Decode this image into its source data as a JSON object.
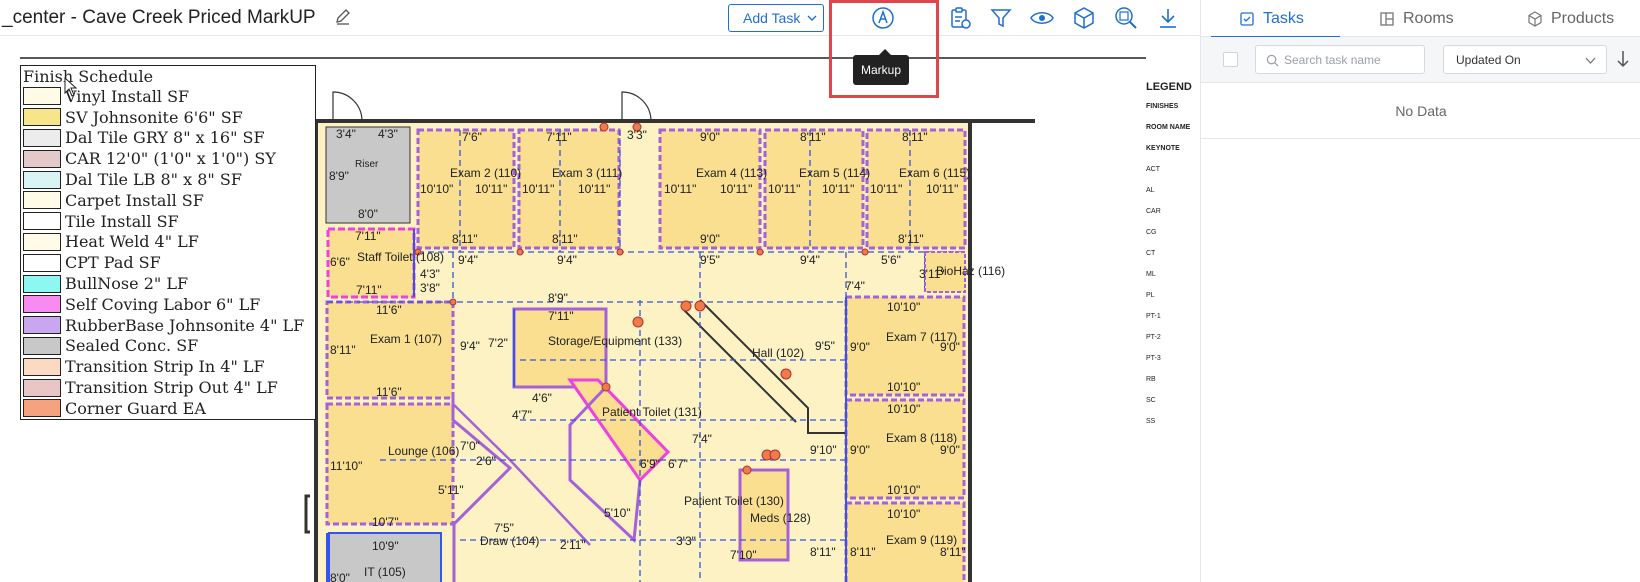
{
  "header": {
    "title": "_center - Cave Creek Priced MarkUP",
    "add_task_label": "Add Task",
    "tooltip": "Markup"
  },
  "toolbar": {
    "icons": [
      "markup-icon",
      "task-list-icon",
      "filter-icon",
      "eye-icon",
      "cube-icon",
      "zoom-icon",
      "download-icon"
    ]
  },
  "panel": {
    "tabs": [
      {
        "label": "Tasks",
        "icon": "task-icon",
        "active": true
      },
      {
        "label": "Rooms",
        "icon": "rooms-icon",
        "active": false
      },
      {
        "label": "Products",
        "icon": "products-icon",
        "active": false
      }
    ],
    "search_placeholder": "Search task name",
    "sort_value": "Updated On",
    "empty_text": "No Data"
  },
  "schedule": {
    "title": "Finish Schedule",
    "items": [
      {
        "label": "Vinyl Install SF",
        "color": "#fffbe6"
      },
      {
        "label": "SV Johnsonite 6'6\" SF",
        "color": "#f7e58c"
      },
      {
        "label": "Dal Tile GRY 8\" x 16\" SF",
        "color": "#ececec"
      },
      {
        "label": "CAR 12'0\" (1'0\" x 1'0\") SY",
        "color": "#e3c9c9"
      },
      {
        "label": "Dal Tile LB 8\" x 8\" SF",
        "color": "#d9f4f4"
      },
      {
        "label": "Carpet Install SF",
        "color": "#fffbe6"
      },
      {
        "label": "Tile Install SF",
        "color": "#ffffff"
      },
      {
        "label": "Heat Weld 4\" LF",
        "color": "#fffbe6"
      },
      {
        "label": "CPT Pad SF",
        "color": "#ffffff"
      },
      {
        "label": "BullNose 2\" LF",
        "color": "#8ff7f2"
      },
      {
        "label": "Self Coving Labor 6\" LF",
        "color": "#f78bf2"
      },
      {
        "label": "RubberBase Johnsonite 4\" LF",
        "color": "#c9a6f0"
      },
      {
        "label": "Sealed Conc. SF",
        "color": "#c8c8c8"
      },
      {
        "label": "Transition Strip In 4\" LF",
        "color": "#fbd9c2"
      },
      {
        "label": "Transition Strip Out 4\" LF",
        "color": "#e8c6c6"
      },
      {
        "label": "Corner Guard EA",
        "color": "#f5a27f"
      }
    ]
  },
  "plan": {
    "rooms": [
      "Exam 2 (110)",
      "Exam 3 (111)",
      "Exam 4 (113)",
      "Exam 5 (114)",
      "Exam 6 (115)",
      "Staff Toilet (108)",
      "Exam 1 (107)",
      "Storage/Equipment (133)",
      "Hall (102)",
      "Exam 7 (117)",
      "Patient Toilet (131)",
      "Lounge (106)",
      "Exam 8 (118)",
      "Patient Toilet (130)",
      "Meds (128)",
      "Draw (104)",
      "Exam 9 (119)",
      "IT (105)",
      "BioHaz (116)",
      "Riser"
    ],
    "dimensions": [
      "3'4\"",
      "4'3\"",
      "7'6\"",
      "7'11\"",
      "3'3\"",
      "9'0\"",
      "8'11\"",
      "8'11\"",
      "8'9\"",
      "10'10\"",
      "10'11\"",
      "10'11\"",
      "10'11\"",
      "10'11\"",
      "10'11\"",
      "10'11\"",
      "8'0\"",
      "8'11\"",
      "8'11\"",
      "9'0\"",
      "8'11\"",
      "7'11\"",
      "6'6\"",
      "7'11\"",
      "9'4\"",
      "9'4\"",
      "9'5\"",
      "9'4\"",
      "5'6\"",
      "4'3\"",
      "3'8\"",
      "8'9\"",
      "11'6\"",
      "8'11\"",
      "11'6\"",
      "9'4\"",
      "7'2\"",
      "10'10\"",
      "9'5\"",
      "10'10\"",
      "9'0\"",
      "11'10\"",
      "10'7\"",
      "10'9\"",
      "8'0\"",
      "5'11\"",
      "6'9\"",
      "6'7\"",
      "7'4\"",
      "9'10\"",
      "10'10\"",
      "10'10\"",
      "8'11\"",
      "7'10\"",
      "3'3\"",
      "2'11\"",
      "5'10\"",
      "7'5\"",
      "2'6\"",
      "7'0\"",
      "4'6\"",
      "4'7\""
    ]
  },
  "legend_side": {
    "title": "LEGEND",
    "items": [
      "FINISHES",
      "ROOM NAME",
      "KEYNOTE",
      "ACT",
      "AL",
      "CAR",
      "CG",
      "CT",
      "ML",
      "PL",
      "PT-1",
      "PT-2",
      "PT-3",
      "RB",
      "SC",
      "SS"
    ]
  }
}
